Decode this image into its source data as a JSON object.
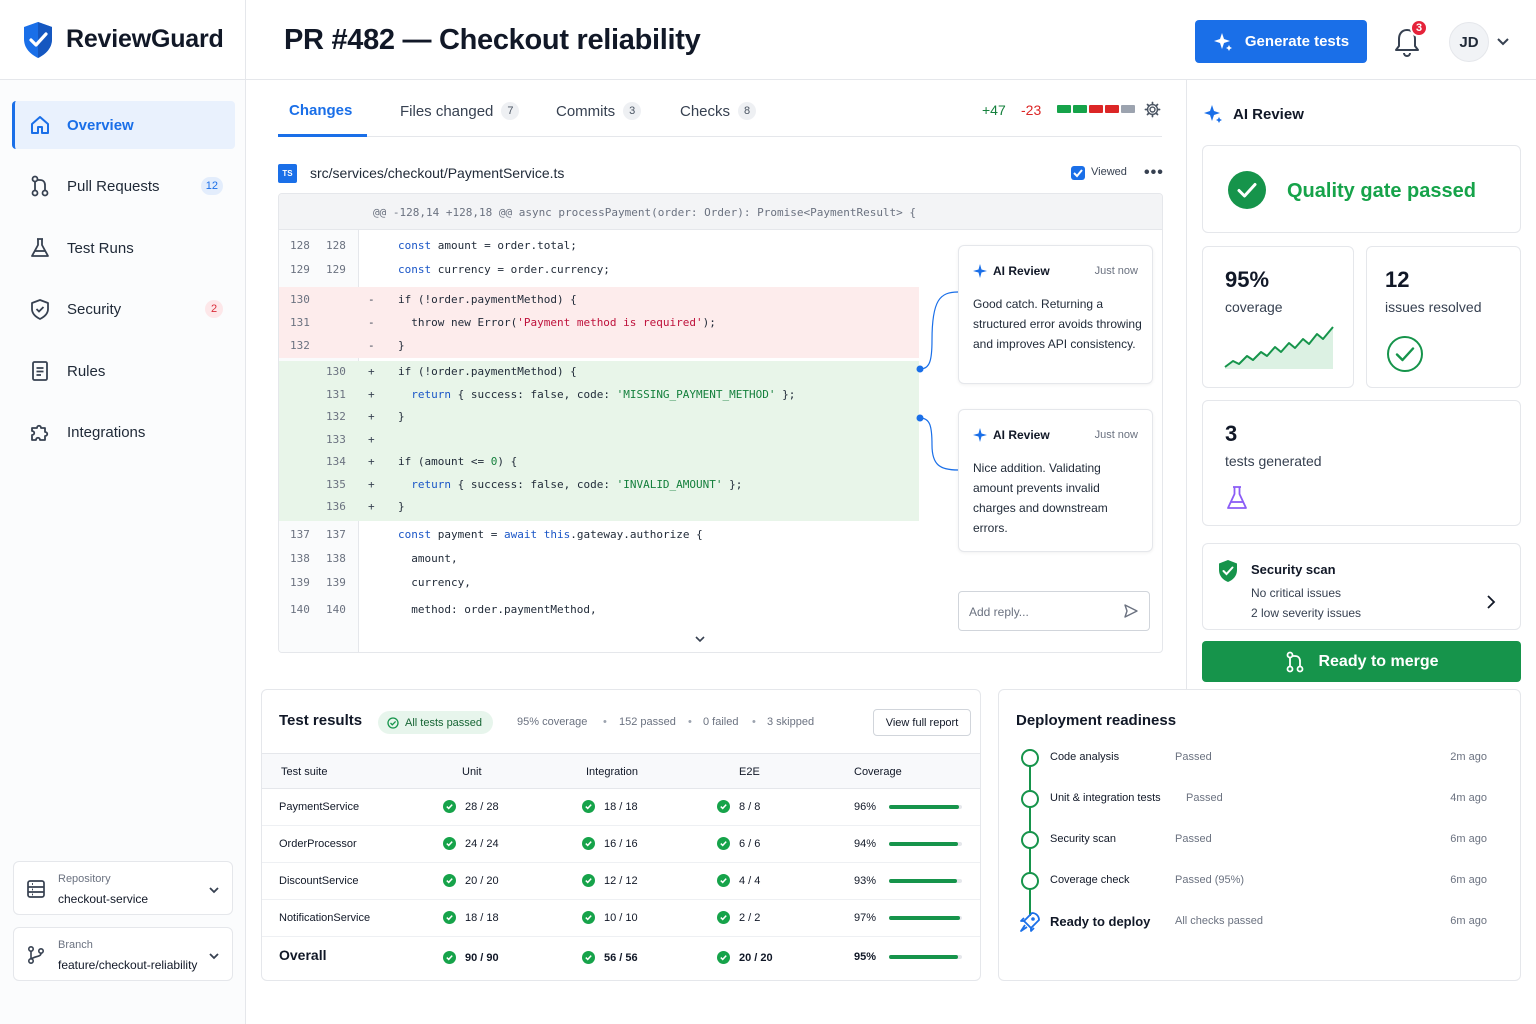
{
  "brand": {
    "name": "ReviewGuard"
  },
  "header": {
    "title": "PR #482 — Checkout reliability",
    "generate_label": "Generate tests",
    "notification_count": "3",
    "avatar_initials": "JD"
  },
  "sidebar": {
    "items": [
      {
        "label": "Overview",
        "icon": "home-icon",
        "active": true
      },
      {
        "label": "Pull Requests",
        "icon": "pull-request-icon",
        "badge": "12"
      },
      {
        "label": "Test Runs",
        "icon": "flask-icon"
      },
      {
        "label": "Security",
        "icon": "shield-icon",
        "badge": "2"
      },
      {
        "label": "Rules",
        "icon": "document-icon"
      },
      {
        "label": "Integrations",
        "icon": "puzzle-icon"
      }
    ],
    "repository": {
      "label": "Repository",
      "value": "checkout-service"
    },
    "branch": {
      "label": "Branch",
      "value": "feature/checkout-reliability"
    }
  },
  "tabs": [
    {
      "label": "Changes",
      "active": true
    },
    {
      "label": "Files changed",
      "count": "7"
    },
    {
      "label": "Commits",
      "count": "3"
    },
    {
      "label": "Checks",
      "count": "8"
    }
  ],
  "diff_stats": {
    "added": "+47",
    "removed": "-23",
    "colors": [
      "#16a34a",
      "#16a34a",
      "#dc2626",
      "#dc2626",
      "#9ca3af"
    ]
  },
  "file": {
    "lang_badge": "TS",
    "path": "src/services/checkout/PaymentService.ts",
    "viewed_label": "Viewed",
    "hunk_header": "@@ -128,14 +128,18 @@ async processPayment(order: Order): Promise<PaymentResult> {"
  },
  "diff_lines": [
    {
      "old": "128",
      "new": "128",
      "sign": "",
      "type": "ctx",
      "code": "const amount = order.total;"
    },
    {
      "old": "129",
      "new": "129",
      "sign": "",
      "type": "ctx",
      "code": "const currency = order.currency;"
    },
    {
      "old": "130",
      "new": "",
      "sign": "-",
      "type": "del",
      "code": "if (!order.paymentMethod) {"
    },
    {
      "old": "131",
      "new": "",
      "sign": "-",
      "type": "del",
      "code": "  throw new Error('Payment method is required');"
    },
    {
      "old": "132",
      "new": "",
      "sign": "-",
      "type": "del",
      "code": "}"
    },
    {
      "old": "",
      "new": "130",
      "sign": "+",
      "type": "add",
      "code": "if (!order.paymentMethod) {"
    },
    {
      "old": "",
      "new": "131",
      "sign": "+",
      "type": "add",
      "code": "  return { success: false, code: 'MISSING_PAYMENT_METHOD' };"
    },
    {
      "old": "",
      "new": "132",
      "sign": "+",
      "type": "add",
      "code": "}"
    },
    {
      "old": "",
      "new": "133",
      "sign": "+",
      "type": "add",
      "code": ""
    },
    {
      "old": "",
      "new": "134",
      "sign": "+",
      "type": "add",
      "code": "if (amount <= 0) {"
    },
    {
      "old": "",
      "new": "135",
      "sign": "+",
      "type": "add",
      "code": "  return { success: false, code: 'INVALID_AMOUNT' };"
    },
    {
      "old": "",
      "new": "136",
      "sign": "+",
      "type": "add",
      "code": "}"
    },
    {
      "old": "137",
      "new": "137",
      "sign": "",
      "type": "ctx",
      "code": "const payment = await this.gateway.authorize {"
    },
    {
      "old": "138",
      "new": "138",
      "sign": "",
      "type": "ctx",
      "code": "  amount,"
    },
    {
      "old": "139",
      "new": "139",
      "sign": "",
      "type": "ctx",
      "code": "  currency,"
    },
    {
      "old": "140",
      "new": "140",
      "sign": "",
      "type": "ctx",
      "code": "  method: order.paymentMethod,"
    }
  ],
  "comments": [
    {
      "author": "AI Review",
      "time": "Just now",
      "body": "Good catch. Returning a structured error avoids throwing and improves API consistency."
    },
    {
      "author": "AI Review",
      "time": "Just now",
      "body": "Nice addition. Validating amount prevents invalid charges and downstream errors."
    }
  ],
  "reply_placeholder": "Add reply...",
  "ai_panel": {
    "title": "AI Review",
    "quality_gate": "Quality gate passed",
    "coverage": {
      "value": "95%",
      "label": "coverage"
    },
    "issues": {
      "value": "12",
      "label": "issues resolved"
    },
    "tests": {
      "value": "3",
      "label": "tests generated"
    },
    "security": {
      "title": "Security scan",
      "line1": "No critical issues",
      "line2": "2 low severity issues"
    },
    "merge_label": "Ready to merge"
  },
  "test_results": {
    "title": "Test results",
    "status": "All tests passed",
    "coverage": "95% coverage",
    "passed": "152 passed",
    "failed": "0 failed",
    "skipped": "3 skipped",
    "report_label": "View full report",
    "columns": [
      "Test suite",
      "Unit",
      "Integration",
      "E2E",
      "Coverage"
    ],
    "rows": [
      {
        "suite": "PaymentService",
        "unit": "28 / 28",
        "integration": "18 / 18",
        "e2e": "8 / 8",
        "coverage": "96%",
        "coverage_value": 0.96
      },
      {
        "suite": "OrderProcessor",
        "unit": "24 / 24",
        "integration": "16 / 16",
        "e2e": "6 / 6",
        "coverage": "94%",
        "coverage_value": 0.94
      },
      {
        "suite": "DiscountService",
        "unit": "20 / 20",
        "integration": "12 / 12",
        "e2e": "4 / 4",
        "coverage": "93%",
        "coverage_value": 0.93
      },
      {
        "suite": "NotificationService",
        "unit": "18 / 18",
        "integration": "10 / 10",
        "e2e": "2 / 2",
        "coverage": "97%",
        "coverage_value": 0.97
      },
      {
        "suite": "Overall",
        "unit": "90 / 90",
        "integration": "56 / 56",
        "e2e": "20 / 20",
        "coverage": "95%",
        "coverage_value": 0.95
      }
    ]
  },
  "deployment": {
    "title": "Deployment readiness",
    "steps": [
      {
        "name": "Code analysis",
        "status": "Passed",
        "ago": "2m ago"
      },
      {
        "name": "Unit & integration tests",
        "status": "Passed",
        "ago": "4m ago"
      },
      {
        "name": "Security scan",
        "status": "Passed",
        "ago": "6m ago"
      },
      {
        "name": "Coverage check",
        "status": "Passed (95%)",
        "ago": "6m ago"
      },
      {
        "name": "Ready to deploy",
        "status": "All checks passed",
        "ago": "6m ago"
      }
    ]
  }
}
